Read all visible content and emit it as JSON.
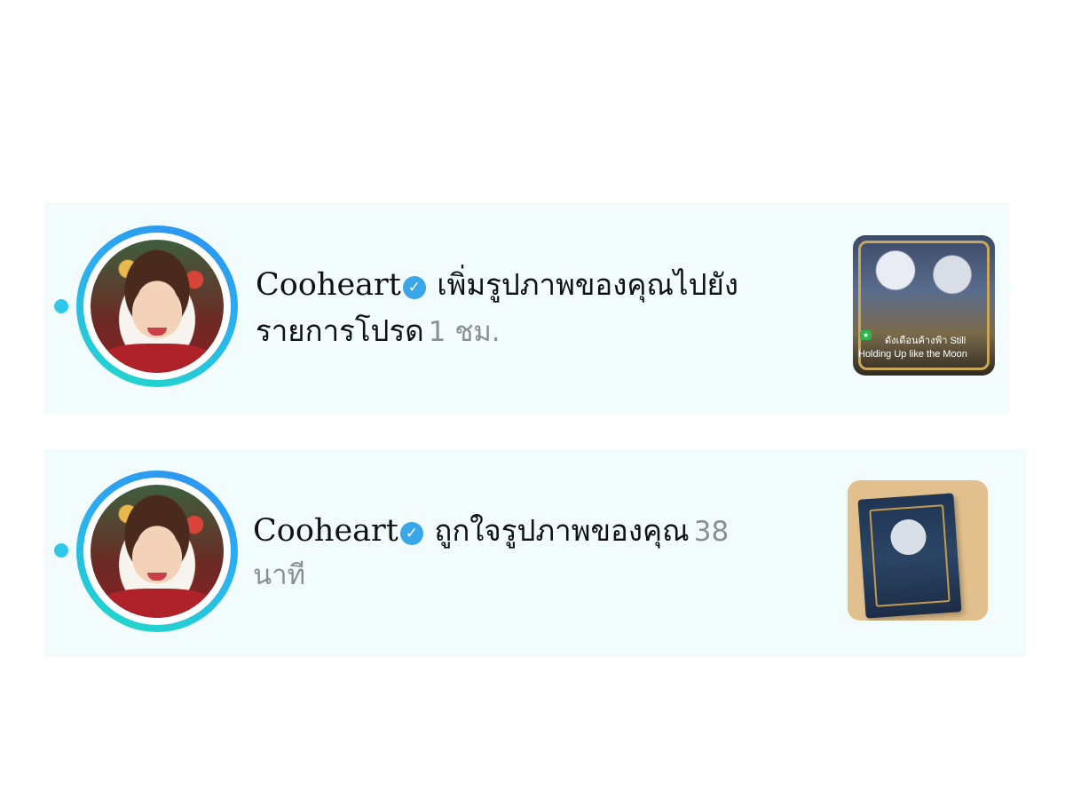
{
  "notifications": [
    {
      "username": "Cooheart",
      "verified_icon": "verified-check-icon",
      "action": " เพิ่มรูปภาพของคุณไปยังรายการโปรด",
      "time": "1 ชม.",
      "thumbnail": {
        "type": "book-cover-image",
        "caption_line1": "ดังเดือนค้างฟ้า Still",
        "caption_line2": "Holding Up like the Moon"
      }
    },
    {
      "username": "Cooheart",
      "verified_icon": "verified-check-icon",
      "action": " ถูกใจรูปภาพของคุณ",
      "time": "38 นาที",
      "thumbnail": {
        "type": "book-photo-image"
      }
    }
  ],
  "colors": {
    "card_background": "#f3fcfd",
    "unread_dot": "#2ec9ea",
    "ring_gradient_start": "#2c8ff0",
    "ring_gradient_end": "#20dcc6",
    "verified_badge": "#39a6e8",
    "time_text": "#8a8f93"
  }
}
